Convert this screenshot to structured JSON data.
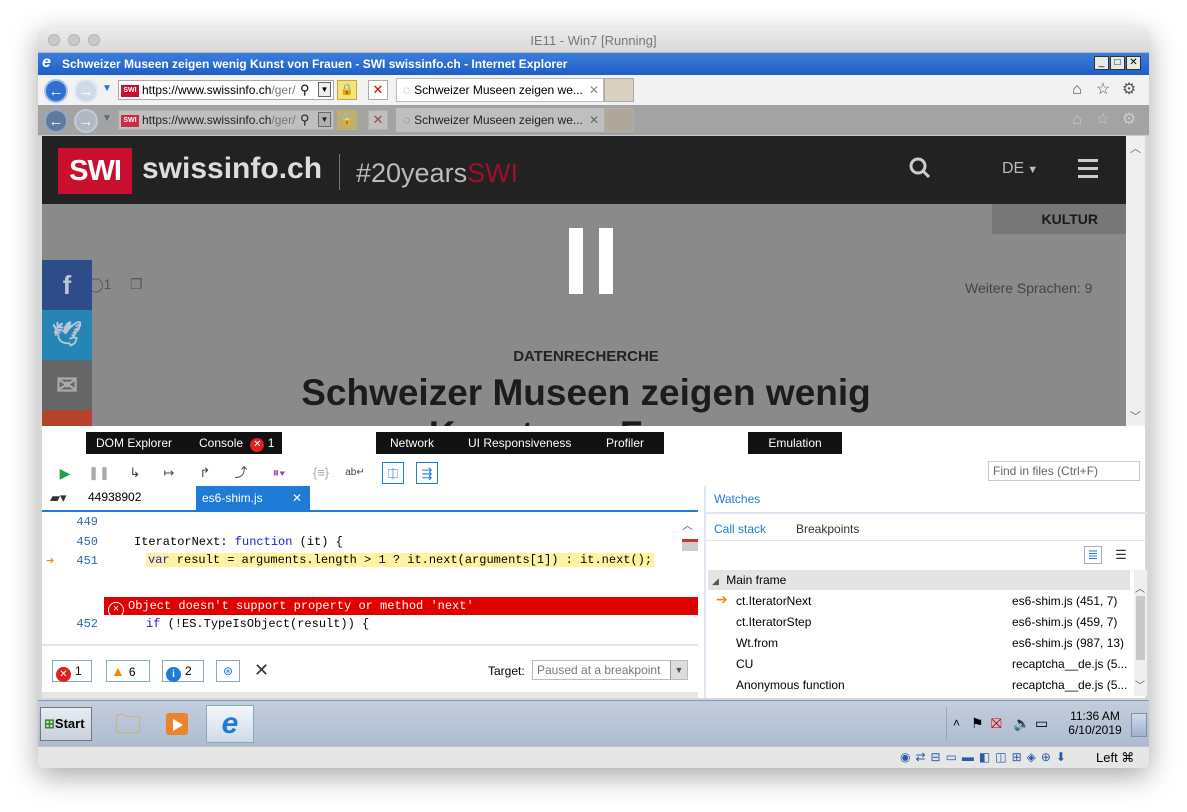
{
  "vm": {
    "title": "IE11 - Win7 [Running]"
  },
  "ie": {
    "window_title": "Schweizer Museen zeigen wenig Kunst von Frauen - SWI swissinfo.ch - Internet Explorer",
    "address_proto": "https://",
    "address_host": "www.swissinfo.ch",
    "address_path": "/ger/",
    "tab_title": "Schweizer Museen zeigen we...",
    "favicon_text": "SWI"
  },
  "site": {
    "logo": "SWI",
    "name": "swissinfo.ch",
    "hashtag_prefix": "#20years",
    "hashtag_brand": "SWI",
    "lang": "DE",
    "section": "KULTUR",
    "comment_count": "1",
    "languages_label": "Weitere Sprachen: 9",
    "kicker": "DATENRECHERCHE",
    "headline_line1": "Schweizer Museen zeigen wenig",
    "headline_line2": "Kunst von Frauen"
  },
  "devtools": {
    "tabs": {
      "dom_explorer": "DOM Explorer",
      "console": "Console",
      "console_count": "1",
      "network": "Network",
      "ui_responsiveness": "UI Responsiveness",
      "profiler": "Profiler",
      "emulation": "Emulation"
    },
    "find_placeholder": "Find in files (Ctrl+F)",
    "file_tabs": {
      "first": "44938902",
      "active": "es6-shim.js"
    },
    "code": {
      "line1_no": "449",
      "line2_no": "450",
      "line2_text_a": "IteratorNext: ",
      "line2_kw": "function",
      "line2_text_b": " (it) {",
      "line3_no": "451",
      "line3_kw": "var",
      "line3_text": " result = arguments.length > 1 ? it.next(arguments[1]) : it.next();",
      "error_text": "Object doesn't support property or method 'next'",
      "line4_no": "452",
      "line4_kw": "if",
      "line4_text": " (!ES.TypeIsObject(result)) {"
    },
    "counts": {
      "errors": "1",
      "warnings": "6",
      "info": "2"
    },
    "target_label": "Target:",
    "target_value": "Paused at a breakpoint",
    "watches_label": "Watches",
    "callstack_label": "Call stack",
    "breakpoints_label": "Breakpoints",
    "main_frame_label": "Main frame",
    "callstack": [
      {
        "fn": "ct.IteratorNext",
        "loc": "es6-shim.js (451, 7)",
        "current": true
      },
      {
        "fn": "ct.IteratorStep",
        "loc": "es6-shim.js (459, 7)",
        "current": false
      },
      {
        "fn": "Wt.from",
        "loc": "es6-shim.js (987, 13)",
        "current": false
      },
      {
        "fn": "CU",
        "loc": "recaptcha__de.js (5...",
        "current": false
      },
      {
        "fn": "Anonymous function",
        "loc": "recaptcha__de.js (5...",
        "current": false
      }
    ]
  },
  "taskbar": {
    "start_label": "Start",
    "time": "11:36 AM",
    "date": "6/10/2019"
  },
  "mac_status": {
    "host_key": "Left ⌘"
  },
  "colors": {
    "ie_blue": "#1d5fc7",
    "swi_red": "#c8102e",
    "error_red": "#e00000",
    "devtools_accent": "#1e7bd6",
    "facebook": "#2f4c8a",
    "twitter": "#2586b6",
    "mail": "#666666",
    "plus": "#b5422d"
  }
}
